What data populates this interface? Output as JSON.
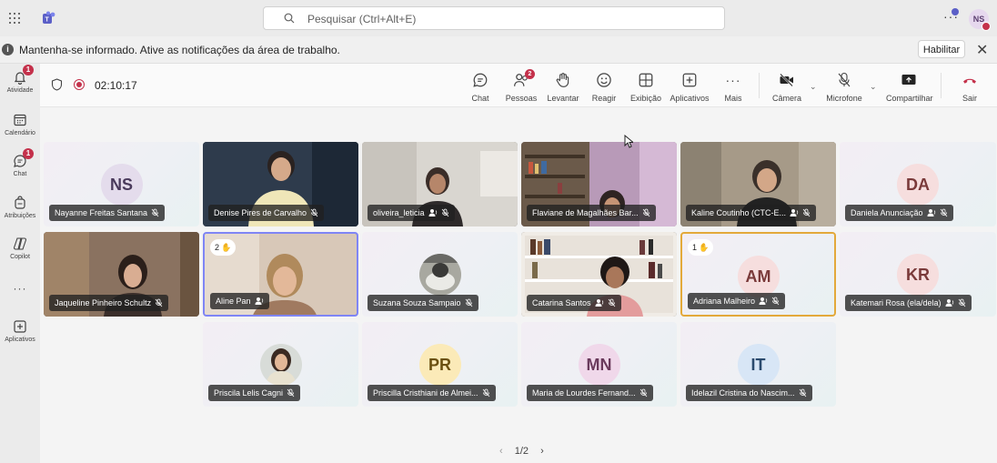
{
  "topbar": {
    "search_placeholder": "Pesquisar (Ctrl+Alt+E)",
    "user_initials": "NS"
  },
  "infobar": {
    "message": "Mantenha-se informado. Ative as notificações da área de trabalho.",
    "enable_label": "Habilitar"
  },
  "rail": {
    "activity": {
      "label": "Atividade",
      "badge": "1"
    },
    "calendar": {
      "label": "Calendário"
    },
    "chat": {
      "label": "Chat",
      "badge": "1"
    },
    "assignments": {
      "label": "Atribuições"
    },
    "copilot": {
      "label": "Copilot"
    },
    "apps": {
      "label": "Aplicativos"
    }
  },
  "meeting": {
    "timer": "02:10:17",
    "controls": {
      "chat": "Chat",
      "people": "Pessoas",
      "people_badge": "2",
      "raise": "Levantar",
      "react": "Reagir",
      "view": "Exibição",
      "apps": "Aplicativos",
      "more": "Mais",
      "camera": "Câmera",
      "mic": "Microfone",
      "share": "Compartilhar",
      "leave": "Sair"
    }
  },
  "participants": [
    {
      "name": "Nayanne Freitas Santana",
      "initials": "NS"
    },
    {
      "name": "Denise Pires de Carvalho"
    },
    {
      "name": "oliveira_leticia"
    },
    {
      "name": "Flaviane de Magalhães Bar..."
    },
    {
      "name": "Kaline Coutinho (CTC-E..."
    },
    {
      "name": "Daniela Anunciação",
      "initials": "DA"
    },
    {
      "name": "Jaqueline Pinheiro Schultz"
    },
    {
      "name": "Aline Pan",
      "hand": "2"
    },
    {
      "name": "Suzana Souza Sampaio"
    },
    {
      "name": "Catarina Santos"
    },
    {
      "name": "Adriana Malheiro",
      "initials": "AM",
      "hand": "1"
    },
    {
      "name": "Katemari Rosa (ela/dela)",
      "initials": "KR"
    },
    {
      "name": "Priscila Lelis Cagni"
    },
    {
      "name": "Priscilla Cristhiani de Almei...",
      "initials": "PR"
    },
    {
      "name": "Maria de Lourdes Fernand...",
      "initials": "MN"
    },
    {
      "name": "Idelazil Cristina do Nascim...",
      "initials": "IT"
    }
  ],
  "pager": {
    "label": "1/2"
  },
  "colors": {
    "accent": "#5b5fc7",
    "badge": "#c4314b",
    "raised_hand_border": "#e3a93a",
    "speaking_border": "#7f85f5"
  }
}
